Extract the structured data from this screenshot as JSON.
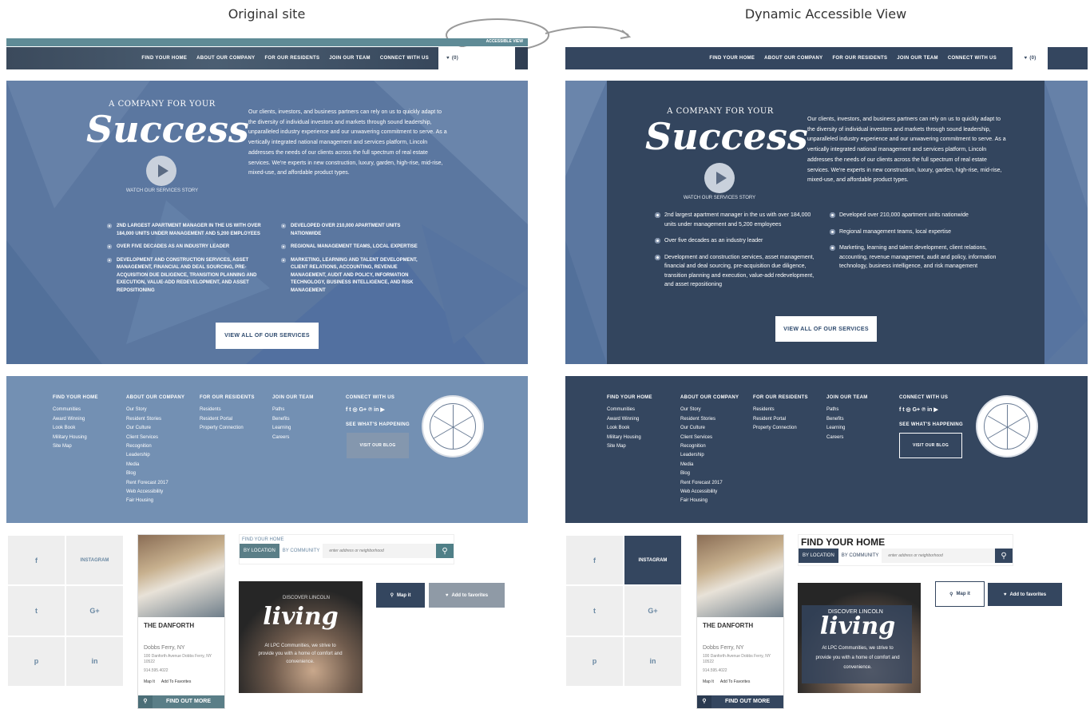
{
  "labels": {
    "original": "Original site",
    "accessible": "Dynamic Accessible View"
  },
  "colors": {
    "orig_hero": "#5b77a0",
    "acc_panel": "#33455e",
    "orig_footer": "#7390b3",
    "acc_footer": "#34465f",
    "teal": "#5f8b96"
  },
  "orig_top": {
    "accessible_link": "ACCESSIBLE VIEW"
  },
  "nav": {
    "items": [
      "FIND YOUR HOME",
      "ABOUT OUR COMPANY",
      "FOR OUR RESIDENTS",
      "JOIN OUR TEAM",
      "CONNECT WITH US"
    ],
    "fav_label": "(0)"
  },
  "hero": {
    "tagline": "A COMPANY FOR YOUR",
    "script": "Success",
    "watch": "WATCH OUR SERVICES STORY",
    "paragraph": "Our clients, investors, and business partners can rely on us to quickly adapt to the diversity of individual investors and markets through sound leadership, unparalleled industry experience and our unwavering commitment to serve. As a vertically integrated national management and services platform, Lincoln addresses the needs of our clients across the full spectrum of real estate services. We're experts in new construction, luxury, garden, high-rise, mid-rise, mixed-use, and affordable product types.",
    "bullets_left_orig": [
      "2ND LARGEST APARTMENT MANAGER IN THE US WITH OVER 184,000 UNITS UNDER MANAGEMENT AND 5,200 EMPLOYEES",
      "OVER FIVE DECADES AS AN INDUSTRY LEADER",
      "DEVELOPMENT AND CONSTRUCTION SERVICES, ASSET MANAGEMENT, FINANCIAL AND DEAL SOURCING, PRE-ACQUISITION DUE DILIGENCE, TRANSITION PLANNING AND EXECUTION, VALUE-ADD REDEVELOPMENT, AND ASSET REPOSITIONING"
    ],
    "bullets_right_orig": [
      "DEVELOPED OVER 210,000 APARTMENT UNITS NATIONWIDE",
      "REGIONAL MANAGEMENT TEAMS, LOCAL EXPERTISE",
      "MARKETING, LEARNING AND TALENT DEVELOPMENT, CLIENT RELATIONS, ACCOUNTING, REVENUE MANAGEMENT, AUDIT AND POLICY, INFORMATION TECHNOLOGY, BUSINESS INTELLIGENCE, AND RISK MANAGEMENT"
    ],
    "bullets_left_acc": [
      "2nd largest apartment manager in the us with over 184,000 units under management and 5,200 employees",
      "Over five decades as an industry leader",
      "Development and construction services, asset management, financial and deal sourcing, pre-acquisition due diligence, transition planning and execution, value-add redevelopment, and asset repositioning"
    ],
    "bullets_right_acc": [
      "Developed over 210,000 apartment units nationwide",
      "Regional management teams, local expertise",
      "Marketing, learning and talent development, client relations, accounting, revenue management, audit and policy, information technology, business intelligence, and risk management"
    ],
    "cta": "VIEW ALL OF OUR SERVICES"
  },
  "footer": {
    "col1": {
      "title": "FIND YOUR HOME",
      "items": [
        "Communities",
        "Award Winning",
        "Look Book",
        "Military Housing",
        "Site Map"
      ]
    },
    "col2": {
      "title": "ABOUT OUR COMPANY",
      "items": [
        "Our Story",
        "Resident Stories",
        "Our Culture",
        "Client Services",
        "Recognition",
        "Leadership",
        "Media",
        "Blog",
        "Rent Forecast 2017",
        "Web Accessibility",
        "Fair Housing"
      ]
    },
    "col3": {
      "title": "FOR OUR RESIDENTS",
      "items": [
        "Residents",
        "Resident Portal",
        "Property Connection"
      ]
    },
    "col4": {
      "title": "JOIN OUR TEAM",
      "items": [
        "Paths",
        "Benefits",
        "Learning",
        "Careers"
      ]
    },
    "col5": {
      "title": "CONNECT WITH US",
      "social": "f  t  ◎  G+  ℗  in  ▶",
      "happening": "SEE WHAT'S HAPPENING",
      "blog": "VISIT OUR BLOG"
    }
  },
  "social_grid": [
    "f",
    "INSTAGRAM",
    "t",
    "G+",
    "p",
    "in"
  ],
  "property": {
    "name": "THE DANFORTH",
    "city": "Dobbs Ferry, NY",
    "address": "100 Danforth Avenue Dobbs Ferry, NY 10522",
    "phone": "914.595.4022",
    "map": "Map It",
    "fav": "Add To Favorites",
    "more": "FIND OUT MORE"
  },
  "fyh": {
    "title_orig": "FIND YOUR HOME",
    "title_acc": "FIND YOUR HOME",
    "by_location": "BY LOCATION",
    "by_community": "BY COMMUNITY",
    "placeholder": "enter address or neighborhood"
  },
  "promo": {
    "discover": "DISCOVER LINCOLN",
    "script": "living",
    "text": "At LPC Communities, we strive to provide you with a home of comfort and convenience."
  },
  "buttons": {
    "map": "Map it",
    "fav": "Add to favorites"
  }
}
